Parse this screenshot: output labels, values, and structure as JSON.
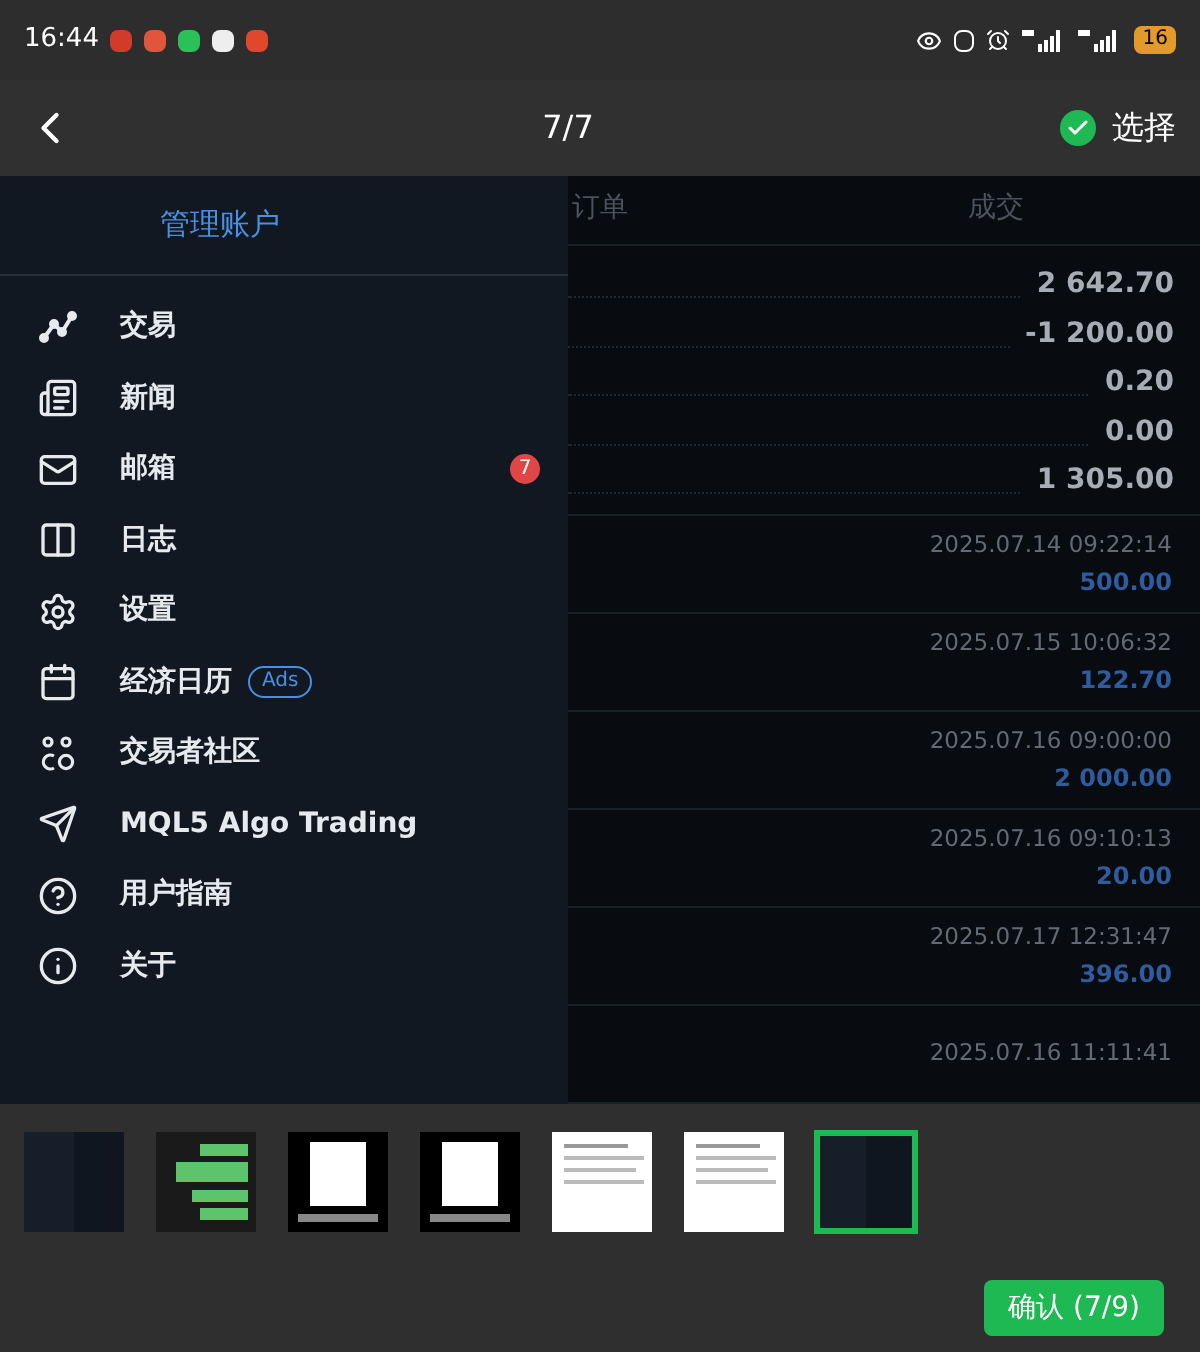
{
  "status_bar": {
    "time": "16:44",
    "battery": "16"
  },
  "top_bar": {
    "title": "7/7",
    "select_label": "选择",
    "selected": true
  },
  "screenshot": {
    "drawer": {
      "header": "管理账户",
      "items": [
        {
          "label": "交易"
        },
        {
          "label": "新闻"
        },
        {
          "label": "邮箱",
          "badge": "7"
        },
        {
          "label": "日志"
        },
        {
          "label": "设置"
        },
        {
          "label": "经济日历",
          "tag": "Ads"
        },
        {
          "label": "交易者社区"
        },
        {
          "label": "MQL5 Algo Trading"
        },
        {
          "label": "用户指南"
        },
        {
          "label": "关于"
        }
      ]
    },
    "columns": [
      "订单",
      "成交"
    ],
    "summary_values": [
      "2 642.70",
      "-1 200.00",
      "0.20",
      "0.00",
      "1 305.00"
    ],
    "deals": [
      {
        "time": "2025.07.14 09:22:14",
        "amount": "500.00"
      },
      {
        "time": "2025.07.15 10:06:32",
        "amount": "122.70"
      },
      {
        "time": "2025.07.16 09:00:00",
        "amount": "2 000.00"
      },
      {
        "time": "2025.07.16 09:10:13",
        "amount": "20.00"
      },
      {
        "time": "2025.07.17 12:31:47",
        "amount": "396.00"
      },
      {
        "time": "2025.07.16 11:11:41"
      }
    ]
  },
  "thumbnails": [
    {
      "kind": "dark",
      "selected": false
    },
    {
      "kind": "chat",
      "selected": false
    },
    {
      "kind": "video",
      "selected": false
    },
    {
      "kind": "video",
      "selected": false
    },
    {
      "kind": "document",
      "selected": false
    },
    {
      "kind": "document",
      "selected": false
    },
    {
      "kind": "dark",
      "selected": true
    }
  ],
  "confirm_button": "确认 (7/9)"
}
